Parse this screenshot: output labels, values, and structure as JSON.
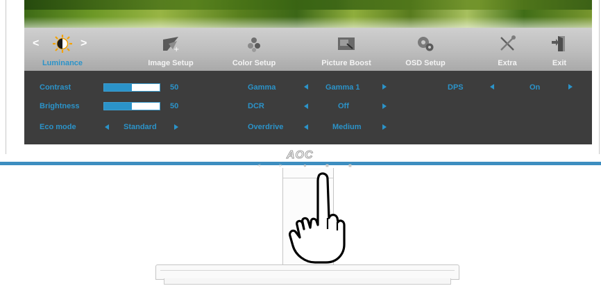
{
  "brand": {
    "logo": "AOC"
  },
  "colors": {
    "accent": "#2b93c9",
    "panel_bg": "#3d3d3d",
    "menubar_bg": "#bdbdbd"
  },
  "menu": {
    "tabs": [
      {
        "label": "Luminance",
        "icon": "sun-contrast-icon",
        "active": true
      },
      {
        "label": "Image Setup",
        "icon": "image-setup-icon",
        "active": false
      },
      {
        "label": "Color Setup",
        "icon": "color-dots-icon",
        "active": false
      },
      {
        "label": "Picture Boost",
        "icon": "picture-boost-icon",
        "active": false
      },
      {
        "label": "OSD Setup",
        "icon": "osd-setup-icon",
        "active": false
      },
      {
        "label": "Extra",
        "icon": "tools-icon",
        "active": false
      },
      {
        "label": "Exit",
        "icon": "exit-door-icon",
        "active": false
      }
    ],
    "prev_chevron": "<",
    "next_chevron": ">"
  },
  "settings": {
    "contrast": {
      "label": "Contrast",
      "value": "50",
      "level": 0.5
    },
    "brightness": {
      "label": "Brightness",
      "value": "50",
      "level": 0.5
    },
    "eco_mode": {
      "label": "Eco mode",
      "value": "Standard"
    },
    "gamma": {
      "label": "Gamma",
      "value": "Gamma 1"
    },
    "dcr": {
      "label": "DCR",
      "value": "Off"
    },
    "overdrive": {
      "label": "Overdrive",
      "value": "Medium"
    },
    "dps": {
      "label": "DPS",
      "value": "On"
    }
  },
  "bezel_keys": [
    "<",
    ">",
    "●",
    "■",
    "■"
  ]
}
